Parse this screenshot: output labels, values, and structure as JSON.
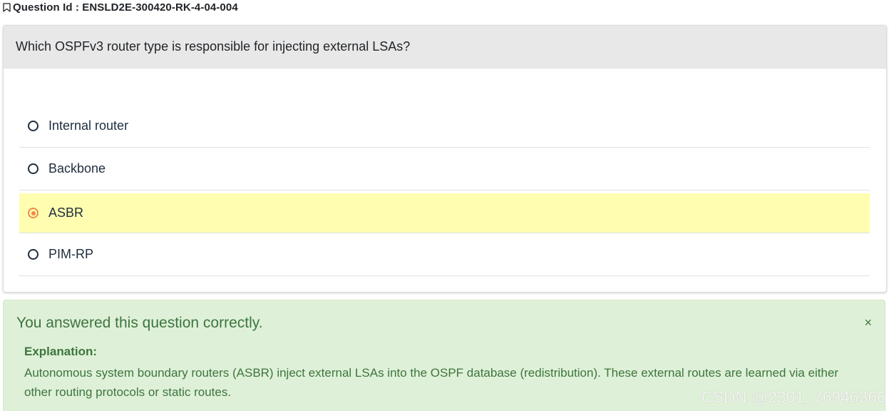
{
  "question": {
    "id_label": "Question Id : ENSLD2E-300420-RK-4-04-004",
    "id_icon": "bookmark-icon",
    "text": "Which OSPFv3 router type is responsible for injecting external LSAs?"
  },
  "options": [
    {
      "label": "Internal router",
      "selected": false
    },
    {
      "label": "Backbone",
      "selected": false
    },
    {
      "label": "ASBR",
      "selected": true
    },
    {
      "label": "PIM-RP",
      "selected": false
    }
  ],
  "feedback": {
    "title": "You answered this question correctly.",
    "close_symbol": "×",
    "explanation_heading": "Explanation:",
    "explanation_text": "Autonomous system boundary routers (ASBR) inject external LSAs into the OSPF database (redistribution). These external routes are learned via either other routing protocols or static routes."
  },
  "watermark": "CSDN @2301_76946366",
  "colors": {
    "header_bg": "#e8e8e8",
    "selected_bg": "#fffeb0",
    "radio_checked": "#f08a4b",
    "success_bg": "#dff0d8",
    "success_text": "#3c763d"
  }
}
